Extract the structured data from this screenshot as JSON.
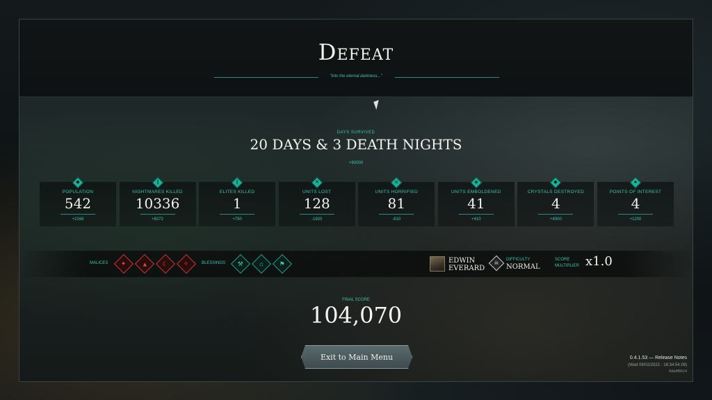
{
  "header": {
    "title": "Defeat",
    "subtitle": "\"Into the eternal darkness...\""
  },
  "days": {
    "label": "DAYS SURVIVED",
    "value": "20 DAYS & 3 DEATH NIGHTS",
    "bonus": "+90000"
  },
  "stats": [
    {
      "label": "POPULATION",
      "value": "542",
      "bonus": "+2168",
      "icon": "population-icon"
    },
    {
      "label": "NIGHTMARES KILLED",
      "value": "10336",
      "bonus": "+8272",
      "icon": "sword-icon"
    },
    {
      "label": "ELITES KILLED",
      "value": "1",
      "bonus": "+750",
      "icon": "sword-icon"
    },
    {
      "label": "UNITS LOST",
      "value": "128",
      "bonus": "-1920",
      "icon": "crossed-swords-icon"
    },
    {
      "label": "UNITS HORRIFIED",
      "value": "81",
      "bonus": "-810",
      "icon": "skull-icon"
    },
    {
      "label": "UNITS EMBOLDENED",
      "value": "41",
      "bonus": "+410",
      "icon": "shield-icon"
    },
    {
      "label": "CRYSTALS DESTROYED",
      "value": "4",
      "bonus": "+4000",
      "icon": "crystal-icon"
    },
    {
      "label": "POINTS OF INTEREST",
      "value": "4",
      "bonus": "+1200",
      "icon": "map-marker-icon"
    }
  ],
  "modifiers": {
    "malices_label": "MALICES",
    "blessings_label": "BLESSINGS",
    "malices": [
      "malice-1-icon",
      "malice-2-icon",
      "malice-3-icon",
      "malice-4-icon"
    ],
    "blessings": [
      "blessing-1-icon",
      "blessing-2-icon",
      "blessing-3-icon"
    ]
  },
  "hero": {
    "name_line1": "Edwin",
    "name_line2": "Everard"
  },
  "difficulty": {
    "label": "DIFFICULTY",
    "value": "Normal"
  },
  "multiplier": {
    "label_line1": "SCORE",
    "label_line2": "MULTIPLIER",
    "value": "x1.0"
  },
  "final_score": {
    "label": "FINAL SCORE",
    "value": "104,070"
  },
  "exit_button": "Exit to Main Menu",
  "version": {
    "release": "0.4.1.53 — Release Notes",
    "date": "(Wed 09/02/2022 - 18:34:54.09)",
    "hash": "9da4f8614"
  },
  "colors": {
    "accent": "#3fc3ae",
    "malice": "#e24545",
    "blessing": "#36c9ab"
  }
}
